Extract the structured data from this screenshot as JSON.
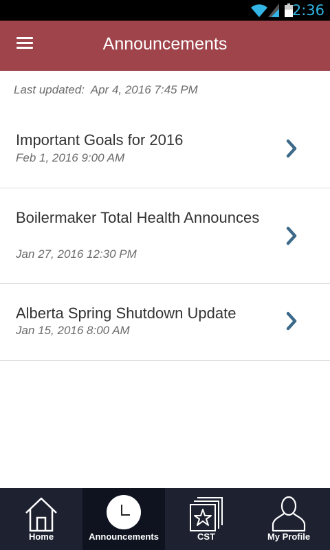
{
  "status_bar": {
    "time": "2:36"
  },
  "header": {
    "title": "Announcements"
  },
  "last_updated": {
    "label": "Last updated:",
    "value": "Apr 4, 2016 7:45 PM"
  },
  "announcements": [
    {
      "title": "Important Goals for 2016",
      "date": "Feb 1, 2016 9:00 AM"
    },
    {
      "title": "Boilermaker Total Health Announces",
      "date": "Jan 27, 2016 12:30 PM"
    },
    {
      "title": "Alberta Spring Shutdown Update",
      "date": "Jan 15, 2016 8:00 AM"
    }
  ],
  "bottom_nav": [
    {
      "label": "Home",
      "icon": "home-icon"
    },
    {
      "label": "Announcements",
      "icon": "clock-icon",
      "active": true
    },
    {
      "label": "CST",
      "icon": "star-badge-icon"
    },
    {
      "label": "My Profile",
      "icon": "person-icon"
    }
  ],
  "colors": {
    "header": "#a0444b",
    "nav_background": "#1e2130",
    "nav_active": "#0f1320",
    "chevron": "#3d6a8a",
    "clock_text": "#33b5e5"
  }
}
